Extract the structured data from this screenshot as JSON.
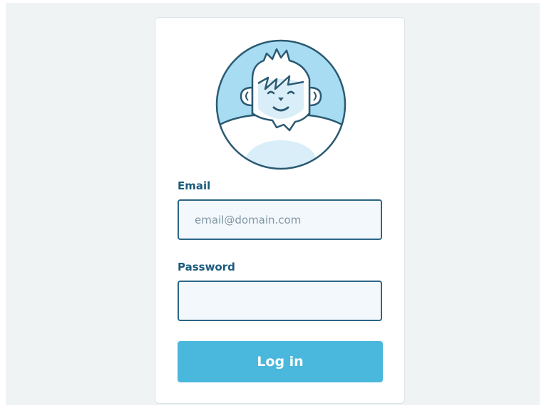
{
  "login_form": {
    "avatar": "yeti-avatar-icon",
    "email": {
      "label": "Email",
      "placeholder": "email@domain.com",
      "value": ""
    },
    "password": {
      "label": "Password",
      "value": ""
    },
    "submit_label": "Log in"
  },
  "colors": {
    "background": "#eff3f4",
    "card": "#ffffff",
    "label": "#1c5b7e",
    "field_border": "#2b6587",
    "field_fill": "#f3f8fd",
    "button": "#4ab8dc",
    "button_text": "#ffffff",
    "avatar_fill": "#a7dcf2",
    "avatar_face": "#d9eef8"
  }
}
